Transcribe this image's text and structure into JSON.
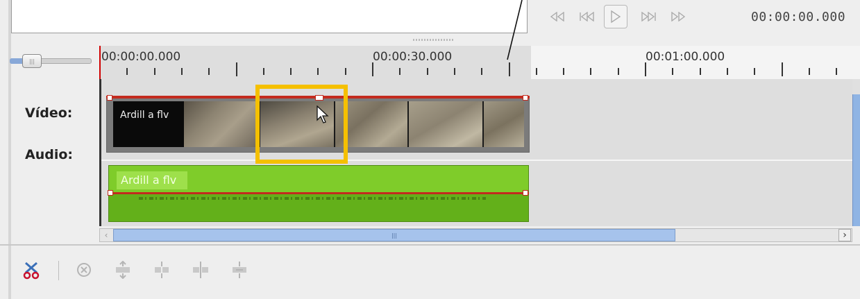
{
  "transport": {
    "timecode": "00:00:00.000",
    "buttons": [
      "rewind-icon",
      "skip-start-icon",
      "play-icon",
      "skip-end-icon",
      "fast-forward-icon"
    ]
  },
  "ruler": {
    "labels": [
      "00:00:00.000",
      "00:00:30.000",
      "00:01:00.000"
    ]
  },
  "tracks": {
    "video_label": "Vídeo:",
    "audio_label": "Audio:"
  },
  "video_clip": {
    "name": "Ardill a flv"
  },
  "audio_clip": {
    "name": "Ardill a flv"
  },
  "colors": {
    "highlight": "#f5c000",
    "clip_border": "#c32a1e",
    "audio_clip": "#7fcc2a",
    "scroll_accent": "#a6c3ec"
  },
  "toolbar": {
    "tools": [
      "split-clip-icon",
      "delete-icon",
      "align-icon",
      "group-icon",
      "ungroup-icon",
      "link-icon"
    ]
  }
}
